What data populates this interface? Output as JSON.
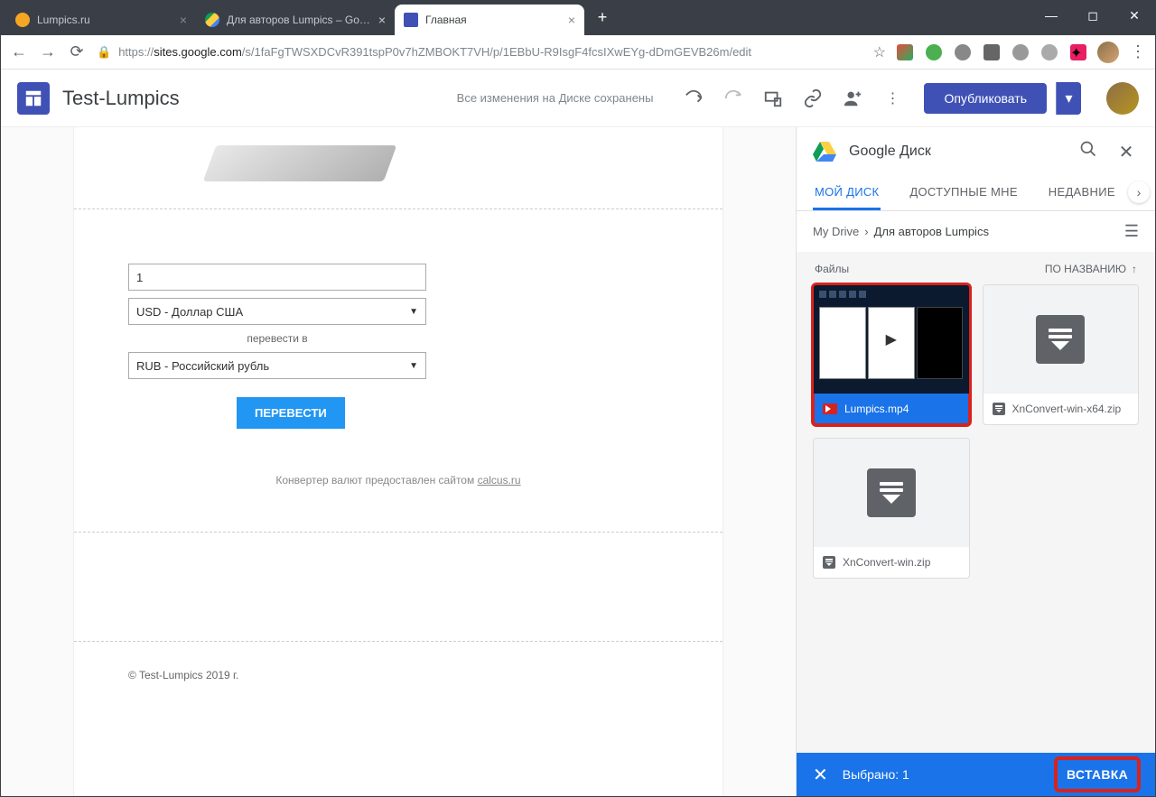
{
  "browser": {
    "tabs": [
      {
        "title": "Lumpics.ru",
        "icon_color": "#f5a623"
      },
      {
        "title": "Для авторов Lumpics – Google Д",
        "icon_color": "#ffcf3f"
      },
      {
        "title": "Главная",
        "icon_color": "#3f51b5"
      }
    ],
    "url_prefix": "https://",
    "url_host": "sites.google.com",
    "url_path": "/s/1faFgTWSXDCvR391tspP0v7hZMBOKT7VH/p/1EBbU-R9IsgF4fcsIXwEYg-dDmGEVB26m/edit"
  },
  "app": {
    "site_title": "Test-Lumpics",
    "save_status": "Все изменения на Диске сохранены",
    "publish_label": "Опубликовать"
  },
  "converter": {
    "value": "1",
    "from": "USD - Доллар США",
    "label": "перевести в",
    "to": "RUB - Российский рубль",
    "button": "ПЕРЕВЕСТИ",
    "footer_text": "Конвертер валют предоставлен сайтом ",
    "footer_link": "calcus.ru",
    "copyright": "© Test-Lumpics 2019 г."
  },
  "drive": {
    "title": "Google Диск",
    "tabs": {
      "my": "МОЙ ДИСК",
      "shared": "ДОСТУПНЫЕ МНЕ",
      "recent": "НЕДАВНИЕ"
    },
    "crumb_root": "My Drive",
    "crumb_sep": "›",
    "crumb_current": "Для авторов Lumpics",
    "files_label": "Файлы",
    "sort_label": "ПО НАЗВАНИЮ",
    "file1": "Lumpics.mp4",
    "file2": "XnConvert-win-x64.zip",
    "file3": "XnConvert-win.zip",
    "selected_text": "Выбрано: 1",
    "insert": "ВСТАВКА"
  }
}
